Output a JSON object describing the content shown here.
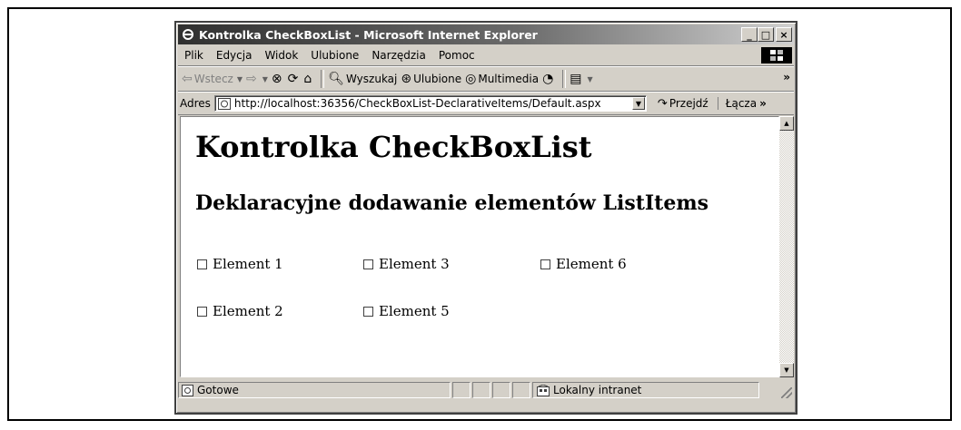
{
  "window": {
    "title": "Kontrolka CheckBoxList - Microsoft Internet Explorer",
    "min_label": "_",
    "max_label": "□",
    "close_label": "×"
  },
  "menu": [
    "Plik",
    "Edycja",
    "Widok",
    "Ulubione",
    "Narzędzia",
    "Pomoc"
  ],
  "toolbar": {
    "back_label": "Wstecz",
    "search_label": "Wyszukaj",
    "favorites_label": "Ulubione",
    "media_label": "Multimedia",
    "more": "»"
  },
  "address": {
    "label": "Adres",
    "url": "http://localhost:36356/CheckBoxList-DeclarativeItems/Default.aspx",
    "go_label": "Przejdź",
    "links_label": "Łącza",
    "links_more": "»"
  },
  "page": {
    "heading": "Kontrolka CheckBoxList",
    "subheading": "Deklaracyjne dodawanie elementów ListItems",
    "checkboxes": [
      {
        "label": "Element 1",
        "checked": false
      },
      {
        "label": "Element 3",
        "checked": false
      },
      {
        "label": "Element 6",
        "checked": false
      },
      {
        "label": "Element 2",
        "checked": false
      },
      {
        "label": "Element 5",
        "checked": false
      }
    ]
  },
  "status": {
    "text": "Gotowe",
    "zone": "Lokalny intranet"
  }
}
